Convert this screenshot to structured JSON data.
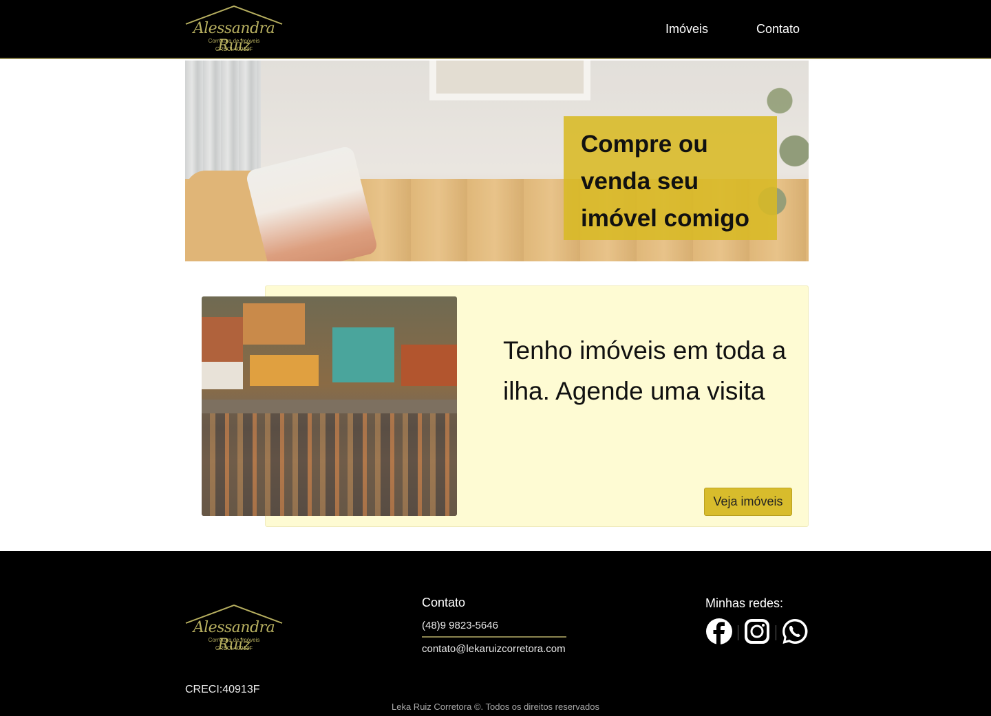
{
  "header": {
    "logo": {
      "name": "Alessandra Ruiz",
      "subtitle": "Corretora de Imóveis",
      "creci": "CRECI:40913F"
    },
    "nav": [
      {
        "label": "Imóveis"
      },
      {
        "label": "Contato"
      }
    ]
  },
  "hero": {
    "headline": "Compre ou venda seu imóvel comigo"
  },
  "feature": {
    "text": "Tenho imóveis em toda a ilha. Agende uma visita",
    "button_label": "Veja imóveis"
  },
  "footer": {
    "logo": {
      "name": "Alessandra Ruiz",
      "subtitle": "Corretora de Imóveis",
      "creci": "CRECI:40913F"
    },
    "creci": "CRECI:40913F",
    "contact": {
      "title": "Contato",
      "phone": "(48)9 9823-5646",
      "email": "contato@lekaruizcorretora.com"
    },
    "social": {
      "title": "Minhas redes:",
      "icons": [
        "facebook-icon",
        "instagram-icon",
        "whatsapp-icon"
      ]
    },
    "copyright": "Leka Ruiz Corretora ©. Todos os direitos reservados"
  },
  "colors": {
    "accent": "#d8bc2c",
    "logo_gold": "#b8b060",
    "feature_bg": "#fefbd3",
    "header_bg": "#000000"
  }
}
